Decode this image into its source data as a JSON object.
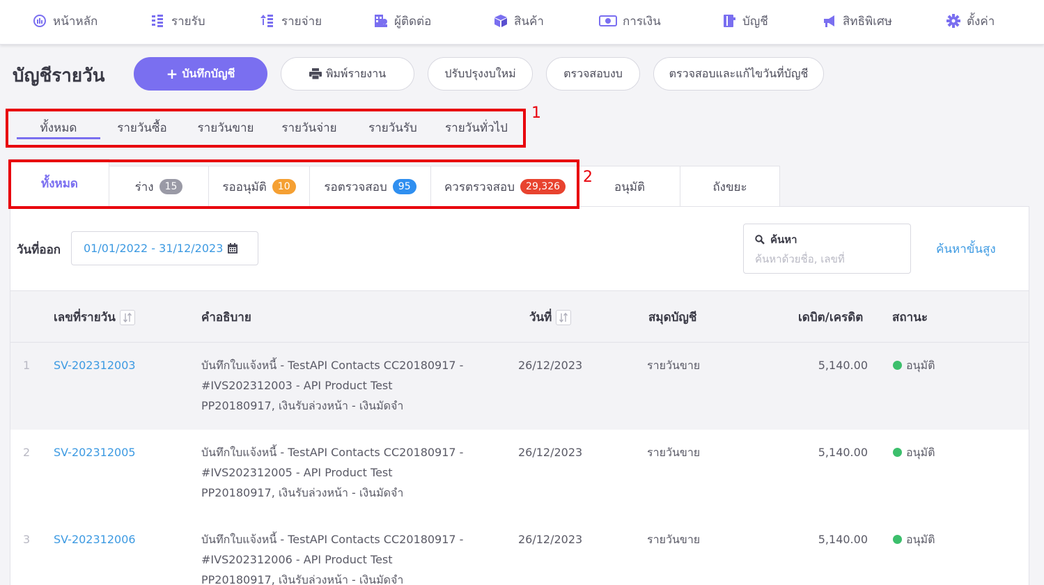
{
  "nav": {
    "items": [
      {
        "label": "หน้าหลัก",
        "icon": "dashboard-icon"
      },
      {
        "label": "รายรับ",
        "icon": "income-list-icon"
      },
      {
        "label": "รายจ่าย",
        "icon": "expense-list-icon"
      },
      {
        "label": "ผู้ติดต่อ",
        "icon": "contacts-icon"
      },
      {
        "label": "สินค้า",
        "icon": "box-icon"
      },
      {
        "label": "การเงิน",
        "icon": "money-icon"
      },
      {
        "label": "บัญชี",
        "icon": "book-icon"
      },
      {
        "label": "สิทธิพิเศษ",
        "icon": "megaphone-icon"
      },
      {
        "label": "ตั้งค่า",
        "icon": "gear-icon"
      }
    ]
  },
  "header": {
    "title": "บัญชีรายวัน",
    "buttons": {
      "record": "บันทึกบัญชี",
      "print": "พิมพ์รายงาน",
      "rebalance": "ปรับปรุงงบใหม่",
      "check": "ตรวจสอบงบ",
      "check_fix": "ตรวจสอบและแก้ไขวันที่บัญชี"
    }
  },
  "journal_tabs": [
    "ทั้งหมด",
    "รายวันซื้อ",
    "รายวันขาย",
    "รายวันจ่าย",
    "รายวันรับ",
    "รายวันทั่วไป"
  ],
  "annotations": {
    "box1": "1",
    "box2": "2"
  },
  "status_tabs": [
    {
      "label": "ทั้งหมด",
      "badge": ""
    },
    {
      "label": "ร่าง",
      "badge": "15"
    },
    {
      "label": "รออนุมัติ",
      "badge": "10"
    },
    {
      "label": "รอตรวจสอบ",
      "badge": "95"
    },
    {
      "label": "ควรตรวจสอบ",
      "badge": "29,326"
    },
    {
      "label": "อนุมัติ",
      "badge": ""
    },
    {
      "label": "ถังขยะ",
      "badge": ""
    }
  ],
  "filters": {
    "date_label": "วันที่ออก",
    "date_range": "01/01/2022 - 31/12/2023",
    "search_label": "ค้นหา",
    "search_placeholder": "ค้นหาด้วยชื่อ, เลขที่",
    "advanced": "ค้นหาขั้นสูง"
  },
  "table": {
    "headers": {
      "doc_no": "เลขที่รายวัน",
      "desc": "คำอธิบาย",
      "date": "วันที่",
      "book": "สมุดบัญชี",
      "amount": "เดบิต/เครดิต",
      "status": "สถานะ"
    },
    "rows": [
      {
        "idx": "1",
        "doc_no": "SV-202312003",
        "desc1": "บันทึกใบแจ้งหนี้ - TestAPI Contacts CC20180917 -",
        "desc2": "#IVS202312003 - API Product Test",
        "desc3": "PP20180917, เงินรับล่วงหน้า - เงินมัดจำ",
        "date": "26/12/2023",
        "book": "รายวันขาย",
        "amount": "5,140.00",
        "status": "อนุมัติ"
      },
      {
        "idx": "2",
        "doc_no": "SV-202312005",
        "desc1": "บันทึกใบแจ้งหนี้ - TestAPI Contacts CC20180917 -",
        "desc2": "#IVS202312005 - API Product Test",
        "desc3": "PP20180917, เงินรับล่วงหน้า - เงินมัดจำ",
        "date": "26/12/2023",
        "book": "รายวันขาย",
        "amount": "5,140.00",
        "status": "อนุมัติ"
      },
      {
        "idx": "3",
        "doc_no": "SV-202312006",
        "desc1": "บันทึกใบแจ้งหนี้ - TestAPI Contacts CC20180917 -",
        "desc2": "#IVS202312006 - API Product Test",
        "desc3": "PP20180917, เงินรับล่วงหน้า - เงินมัดจำ",
        "date": "26/12/2023",
        "book": "รายวันขาย",
        "amount": "5,140.00",
        "status": "อนุมัติ"
      }
    ]
  },
  "colors": {
    "accent": "#7a6ff0",
    "link": "#3d9ae2",
    "annotation": "#e8000b",
    "badge_draft": "#9a9aa6",
    "badge_pending": "#f5a033",
    "badge_review": "#2f8ff0",
    "badge_should_check": "#e8432f",
    "status_ok": "#3cbf6c"
  }
}
